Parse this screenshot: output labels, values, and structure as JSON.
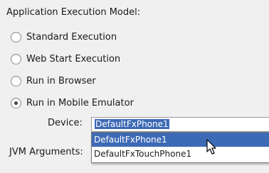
{
  "section_label": "Application Execution Model:",
  "radios": [
    {
      "label": "Standard Execution",
      "selected": false
    },
    {
      "label": "Web Start Execution",
      "selected": false
    },
    {
      "label": "Run in Browser",
      "selected": false
    },
    {
      "label": "Run in Mobile Emulator",
      "selected": true
    }
  ],
  "device": {
    "label": "Device:",
    "value": "DefaultFxPhone1",
    "options": [
      "DefaultFxPhone1",
      "DefaultFxTouchPhone1"
    ],
    "highlighted_option": "DefaultFxPhone1"
  },
  "jvm_label": "JVM Arguments:",
  "cursor_icon": "arrow-cursor-icon"
}
